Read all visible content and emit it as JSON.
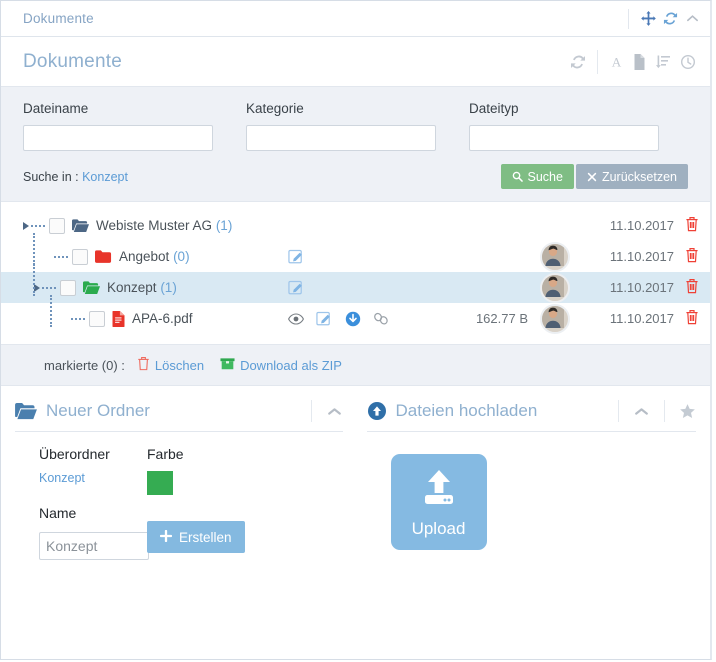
{
  "window": {
    "title": "Dokumente",
    "tools": [
      {
        "name": "move-icon",
        "label": "Verschieben"
      },
      {
        "name": "refresh-icon",
        "label": "Aktualisieren"
      },
      {
        "name": "collapse-icon",
        "label": "Einklappen"
      }
    ]
  },
  "panel": {
    "title": "Dokumente",
    "tools": [
      {
        "name": "refresh-icon",
        "label": "Aktualisieren"
      },
      {
        "name": "font-icon",
        "label": "A"
      },
      {
        "name": "file-icon",
        "label": "Datei"
      },
      {
        "name": "sort-amount-down-icon",
        "label": "Sortieren"
      },
      {
        "name": "clock-icon",
        "label": "Verlauf"
      }
    ]
  },
  "search": {
    "fields": [
      {
        "label": "Dateiname",
        "value": "",
        "placeholder": ""
      },
      {
        "label": "Kategorie",
        "value": "",
        "placeholder": ""
      },
      {
        "label": "Dateityp",
        "value": "",
        "placeholder": ""
      }
    ],
    "scope_label": "Suche in :",
    "scope_value": "Konzept",
    "search_button": "Suche",
    "reset_button": "Zurücksetzen"
  },
  "tree": {
    "rows": [
      {
        "name": "Webiste Muster AG",
        "count": "(1)",
        "icon": "folder-open-icon",
        "icon_color": "#4d6785",
        "depth": 0,
        "selected": false,
        "expandable": true,
        "actions": [],
        "size": "",
        "avatar": false,
        "date": "11.10.2017",
        "delete": "delete-icon"
      },
      {
        "name": "Angebot",
        "count": "(0)",
        "icon": "folder-icon",
        "icon_color": "#e8342a",
        "depth": 1,
        "selected": false,
        "expandable": false,
        "actions": [
          "edit-icon"
        ],
        "size": "",
        "avatar": true,
        "date": "11.10.2017",
        "delete": "delete-icon"
      },
      {
        "name": "Konzept",
        "count": "(1)",
        "icon": "folder-open-icon",
        "icon_color": "#2bab4e",
        "depth": 1,
        "selected": true,
        "expandable": true,
        "actions": [
          "edit-icon"
        ],
        "size": "",
        "avatar": true,
        "date": "11.10.2017",
        "delete": "delete-icon"
      },
      {
        "name": "APA-6.pdf",
        "count": "",
        "icon": "pdf-file-icon",
        "icon_color": "#e8342a",
        "depth": 2,
        "selected": false,
        "expandable": false,
        "actions": [
          "eye-icon",
          "edit-icon",
          "download-icon",
          "link-icon"
        ],
        "size": "162.77 B",
        "avatar": true,
        "date": "11.10.2017",
        "delete": "delete-icon"
      }
    ]
  },
  "markbar": {
    "label": "markierte (0) :",
    "delete_label": "Löschen",
    "zip_label": "Download als ZIP"
  },
  "new_folder": {
    "title": "Neuer Ordner",
    "icon": "folder-open-icon",
    "collapse_icon": "chevron-up-icon",
    "parent_label": "Überordner",
    "parent_value": "Konzept",
    "color_label": "Farbe",
    "color_value": "#35ac52",
    "name_label": "Name",
    "name_value": "",
    "name_placeholder": "Konzept",
    "create_label": "Erstellen"
  },
  "upload": {
    "title": "Dateien hochladen",
    "icon": "arrow-up-circle-icon",
    "collapse_icon": "chevron-up-icon",
    "star_icon": "star-icon",
    "button_label": "Upload"
  },
  "colors": {
    "accent_blue": "#5b9bd5",
    "title_blue": "#8fb0cf",
    "green_button": "#7fbd84",
    "grey_button": "#9fb0c0",
    "selected_row": "#d9e9f3",
    "panel_bg": "#eef1f6",
    "red": "#e8342a",
    "green_folder": "#2bab4e"
  }
}
